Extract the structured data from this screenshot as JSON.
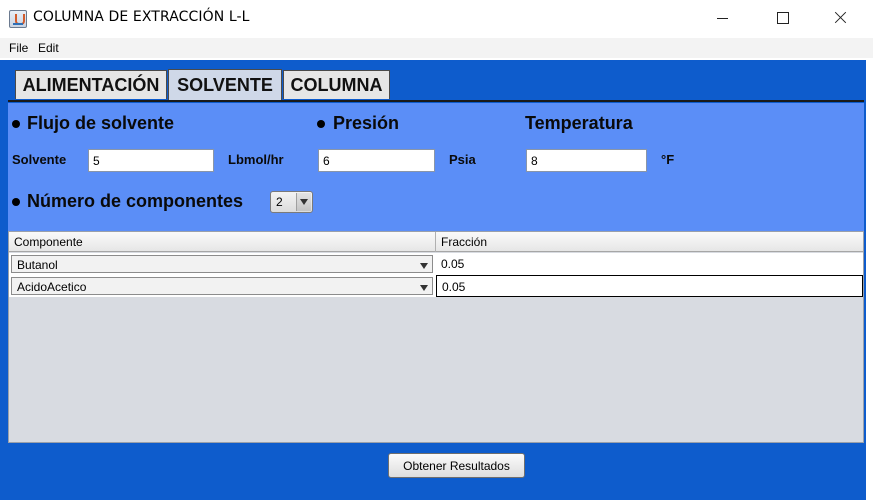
{
  "window": {
    "title": "COLUMNA DE EXTRACCIÓN L-L"
  },
  "menu": {
    "file": "File",
    "edit": "Edit"
  },
  "tabs": [
    {
      "label": "ALIMENTACIÓN",
      "selected": false
    },
    {
      "label": "SOLVENTE",
      "selected": true
    },
    {
      "label": "COLUMNA",
      "selected": false
    }
  ],
  "solvente": {
    "flujo_title": "Flujo de solvente",
    "presion_title": "Presión",
    "temperatura_title": "Temperatura",
    "solvente_label": "Solvente",
    "solvente_value": "5",
    "flujo_unit": "Lbmol/hr",
    "presion_value": "6",
    "presion_unit": "Psia",
    "temperatura_value": "8",
    "temperatura_unit": "°F",
    "num_componentes_label": "Número de componentes",
    "num_componentes_value": "2"
  },
  "table": {
    "columns": [
      "Componente",
      "Fracción"
    ],
    "rows": [
      {
        "componente": "Butanol",
        "fraccion": "0.05"
      },
      {
        "componente": "AcidoAcetico",
        "fraccion": "0.05"
      }
    ]
  },
  "actions": {
    "obtener_resultados": "Obtener Resultados"
  },
  "colors": {
    "frame_blue": "#0e5ccc",
    "panel_blue": "#5b8ef7",
    "table_bg": "#d8dbe1"
  }
}
